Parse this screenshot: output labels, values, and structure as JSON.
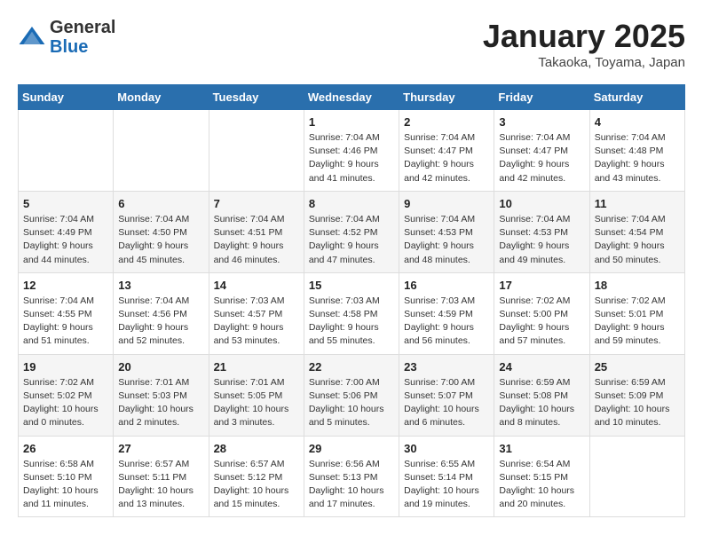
{
  "header": {
    "logo_general": "General",
    "logo_blue": "Blue",
    "title": "January 2025",
    "subtitle": "Takaoka, Toyama, Japan"
  },
  "weekdays": [
    "Sunday",
    "Monday",
    "Tuesday",
    "Wednesday",
    "Thursday",
    "Friday",
    "Saturday"
  ],
  "rows": [
    [
      {
        "num": "",
        "info": ""
      },
      {
        "num": "",
        "info": ""
      },
      {
        "num": "",
        "info": ""
      },
      {
        "num": "1",
        "info": "Sunrise: 7:04 AM\nSunset: 4:46 PM\nDaylight: 9 hours and 41 minutes."
      },
      {
        "num": "2",
        "info": "Sunrise: 7:04 AM\nSunset: 4:47 PM\nDaylight: 9 hours and 42 minutes."
      },
      {
        "num": "3",
        "info": "Sunrise: 7:04 AM\nSunset: 4:47 PM\nDaylight: 9 hours and 42 minutes."
      },
      {
        "num": "4",
        "info": "Sunrise: 7:04 AM\nSunset: 4:48 PM\nDaylight: 9 hours and 43 minutes."
      }
    ],
    [
      {
        "num": "5",
        "info": "Sunrise: 7:04 AM\nSunset: 4:49 PM\nDaylight: 9 hours and 44 minutes."
      },
      {
        "num": "6",
        "info": "Sunrise: 7:04 AM\nSunset: 4:50 PM\nDaylight: 9 hours and 45 minutes."
      },
      {
        "num": "7",
        "info": "Sunrise: 7:04 AM\nSunset: 4:51 PM\nDaylight: 9 hours and 46 minutes."
      },
      {
        "num": "8",
        "info": "Sunrise: 7:04 AM\nSunset: 4:52 PM\nDaylight: 9 hours and 47 minutes."
      },
      {
        "num": "9",
        "info": "Sunrise: 7:04 AM\nSunset: 4:53 PM\nDaylight: 9 hours and 48 minutes."
      },
      {
        "num": "10",
        "info": "Sunrise: 7:04 AM\nSunset: 4:53 PM\nDaylight: 9 hours and 49 minutes."
      },
      {
        "num": "11",
        "info": "Sunrise: 7:04 AM\nSunset: 4:54 PM\nDaylight: 9 hours and 50 minutes."
      }
    ],
    [
      {
        "num": "12",
        "info": "Sunrise: 7:04 AM\nSunset: 4:55 PM\nDaylight: 9 hours and 51 minutes."
      },
      {
        "num": "13",
        "info": "Sunrise: 7:04 AM\nSunset: 4:56 PM\nDaylight: 9 hours and 52 minutes."
      },
      {
        "num": "14",
        "info": "Sunrise: 7:03 AM\nSunset: 4:57 PM\nDaylight: 9 hours and 53 minutes."
      },
      {
        "num": "15",
        "info": "Sunrise: 7:03 AM\nSunset: 4:58 PM\nDaylight: 9 hours and 55 minutes."
      },
      {
        "num": "16",
        "info": "Sunrise: 7:03 AM\nSunset: 4:59 PM\nDaylight: 9 hours and 56 minutes."
      },
      {
        "num": "17",
        "info": "Sunrise: 7:02 AM\nSunset: 5:00 PM\nDaylight: 9 hours and 57 minutes."
      },
      {
        "num": "18",
        "info": "Sunrise: 7:02 AM\nSunset: 5:01 PM\nDaylight: 9 hours and 59 minutes."
      }
    ],
    [
      {
        "num": "19",
        "info": "Sunrise: 7:02 AM\nSunset: 5:02 PM\nDaylight: 10 hours and 0 minutes."
      },
      {
        "num": "20",
        "info": "Sunrise: 7:01 AM\nSunset: 5:03 PM\nDaylight: 10 hours and 2 minutes."
      },
      {
        "num": "21",
        "info": "Sunrise: 7:01 AM\nSunset: 5:05 PM\nDaylight: 10 hours and 3 minutes."
      },
      {
        "num": "22",
        "info": "Sunrise: 7:00 AM\nSunset: 5:06 PM\nDaylight: 10 hours and 5 minutes."
      },
      {
        "num": "23",
        "info": "Sunrise: 7:00 AM\nSunset: 5:07 PM\nDaylight: 10 hours and 6 minutes."
      },
      {
        "num": "24",
        "info": "Sunrise: 6:59 AM\nSunset: 5:08 PM\nDaylight: 10 hours and 8 minutes."
      },
      {
        "num": "25",
        "info": "Sunrise: 6:59 AM\nSunset: 5:09 PM\nDaylight: 10 hours and 10 minutes."
      }
    ],
    [
      {
        "num": "26",
        "info": "Sunrise: 6:58 AM\nSunset: 5:10 PM\nDaylight: 10 hours and 11 minutes."
      },
      {
        "num": "27",
        "info": "Sunrise: 6:57 AM\nSunset: 5:11 PM\nDaylight: 10 hours and 13 minutes."
      },
      {
        "num": "28",
        "info": "Sunrise: 6:57 AM\nSunset: 5:12 PM\nDaylight: 10 hours and 15 minutes."
      },
      {
        "num": "29",
        "info": "Sunrise: 6:56 AM\nSunset: 5:13 PM\nDaylight: 10 hours and 17 minutes."
      },
      {
        "num": "30",
        "info": "Sunrise: 6:55 AM\nSunset: 5:14 PM\nDaylight: 10 hours and 19 minutes."
      },
      {
        "num": "31",
        "info": "Sunrise: 6:54 AM\nSunset: 5:15 PM\nDaylight: 10 hours and 20 minutes."
      },
      {
        "num": "",
        "info": ""
      }
    ]
  ]
}
